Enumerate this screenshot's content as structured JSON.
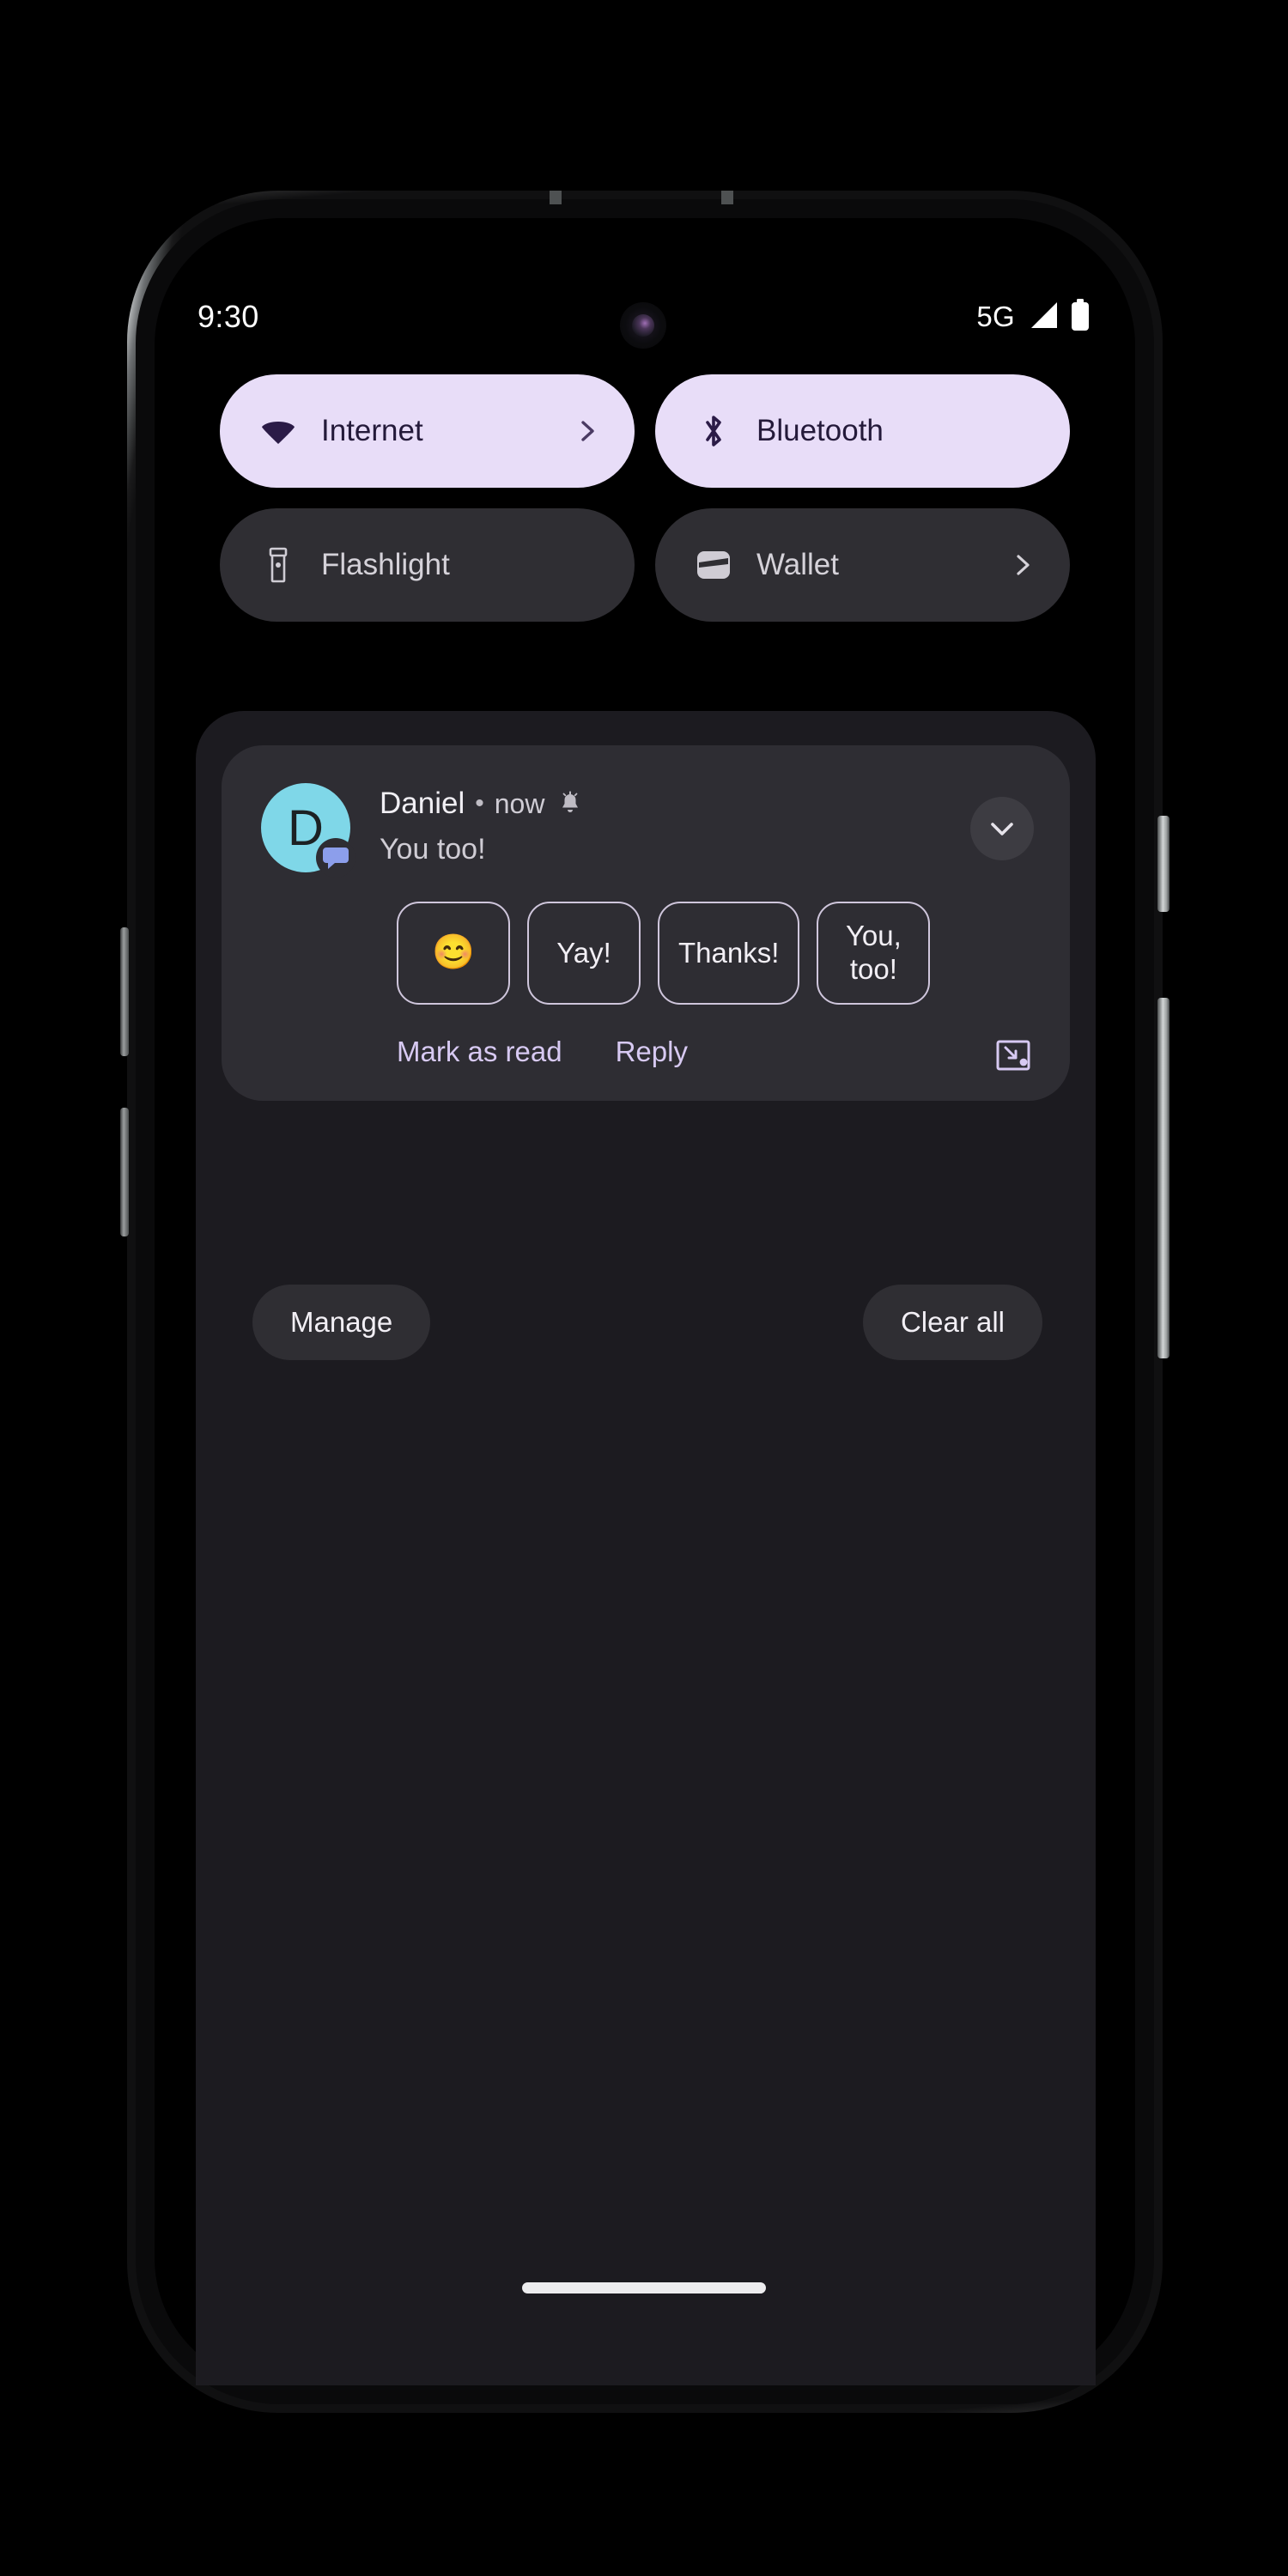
{
  "status_bar": {
    "time": "9:30",
    "network_label": "5G",
    "signal_icon": "signal-bars-icon",
    "battery_icon": "battery-full-icon"
  },
  "quick_settings": {
    "tiles": [
      {
        "label": "Internet",
        "icon": "wifi-icon",
        "state": "active",
        "chevron": true
      },
      {
        "label": "Bluetooth",
        "icon": "bluetooth-icon",
        "state": "active",
        "chevron": false
      },
      {
        "label": "Flashlight",
        "icon": "flashlight-icon",
        "state": "inactive",
        "chevron": false
      },
      {
        "label": "Wallet",
        "icon": "wallet-icon",
        "state": "inactive",
        "chevron": true
      }
    ]
  },
  "notification": {
    "avatar_initial": "D",
    "avatar_badge_icon": "chat-bubble-icon",
    "sender": "Daniel",
    "separator": "•",
    "time": "now",
    "alert_icon": "bell-icon",
    "message": "You too!",
    "expand_icon": "chevron-down-icon",
    "smart_replies": [
      {
        "label": "😊",
        "kind": "emoji"
      },
      {
        "label": "Yay!",
        "kind": "text"
      },
      {
        "label": "Thanks!",
        "kind": "text"
      },
      {
        "label": "You, too!",
        "kind": "text"
      }
    ],
    "actions": [
      {
        "label": "Mark as read"
      },
      {
        "label": "Reply"
      }
    ],
    "bubble_icon": "bubble-expand-icon"
  },
  "footer": {
    "manage_label": "Manage",
    "clear_all_label": "Clear all"
  },
  "colors": {
    "tile_active_bg": "#E8DDF8",
    "tile_active_fg": "#241A3A",
    "tile_inactive_bg": "#2F2E33",
    "tile_inactive_fg": "#D5D2D9",
    "shade_bg": "#1C1B20",
    "card_bg": "#2E2D33",
    "accent_purple": "#D7C9F2",
    "avatar_bg": "#7FD7E8",
    "badge_blue": "#8C9EEB"
  }
}
